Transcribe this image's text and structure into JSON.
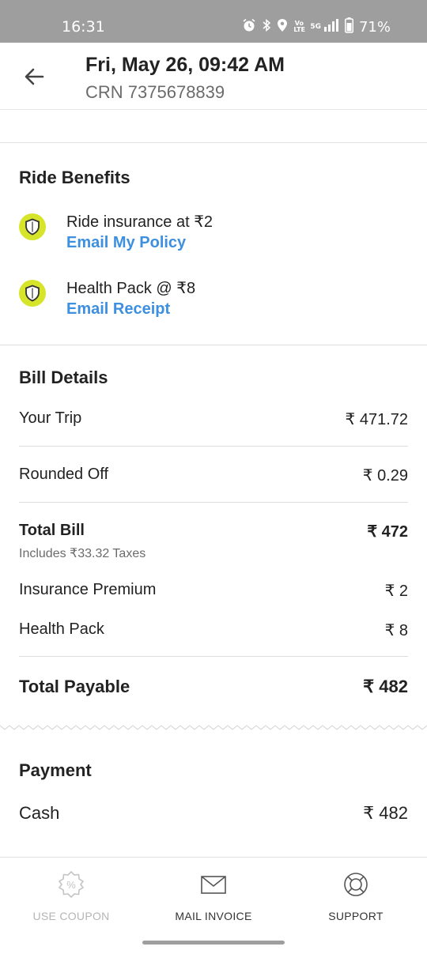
{
  "status_bar": {
    "time": "16:31",
    "battery": "71%",
    "network_label": "5G",
    "volte_label": "Vo LTE",
    "icons": [
      "alarm-icon",
      "bluetooth-icon",
      "location-icon",
      "volte-icon",
      "signal-icon",
      "battery-icon"
    ]
  },
  "header": {
    "title": "Fri, May 26, 09:42 AM",
    "crn": "CRN 7375678839",
    "back_icon": "back-arrow-icon"
  },
  "ride_benefits": {
    "title": "Ride Benefits",
    "items": [
      {
        "text": "Ride insurance at ₹2",
        "link": "Email My Policy",
        "icon": "shield-icon"
      },
      {
        "text": "Health Pack @ ₹8",
        "link": "Email Receipt",
        "icon": "shield-icon"
      }
    ]
  },
  "bill_details": {
    "title": "Bill Details",
    "your_trip": {
      "label": "Your Trip",
      "value": "₹ 471.72"
    },
    "rounded_off": {
      "label": "Rounded Off",
      "value": "₹ 0.29"
    },
    "total_bill": {
      "label": "Total Bill",
      "value": "₹ 472",
      "note": "Includes ₹33.32 Taxes"
    },
    "insurance": {
      "label": "Insurance Premium",
      "value": "₹ 2"
    },
    "health_pack": {
      "label": "Health Pack",
      "value": "₹ 8"
    },
    "total_payable": {
      "label": "Total Payable",
      "value": "₹ 482"
    }
  },
  "payment": {
    "title": "Payment",
    "method": "Cash",
    "amount": "₹ 482"
  },
  "bottom_bar": {
    "items": [
      {
        "label": "USE COUPON",
        "icon": "coupon-icon",
        "enabled": false
      },
      {
        "label": "MAIL INVOICE",
        "icon": "mail-icon",
        "enabled": true
      },
      {
        "label": "SUPPORT",
        "icon": "support-lifebuoy-icon",
        "enabled": true
      }
    ]
  },
  "colors": {
    "status_bar": "#9e9e9e",
    "accent_link": "#3d8fe0",
    "shield_badge": "#d7e52a"
  }
}
